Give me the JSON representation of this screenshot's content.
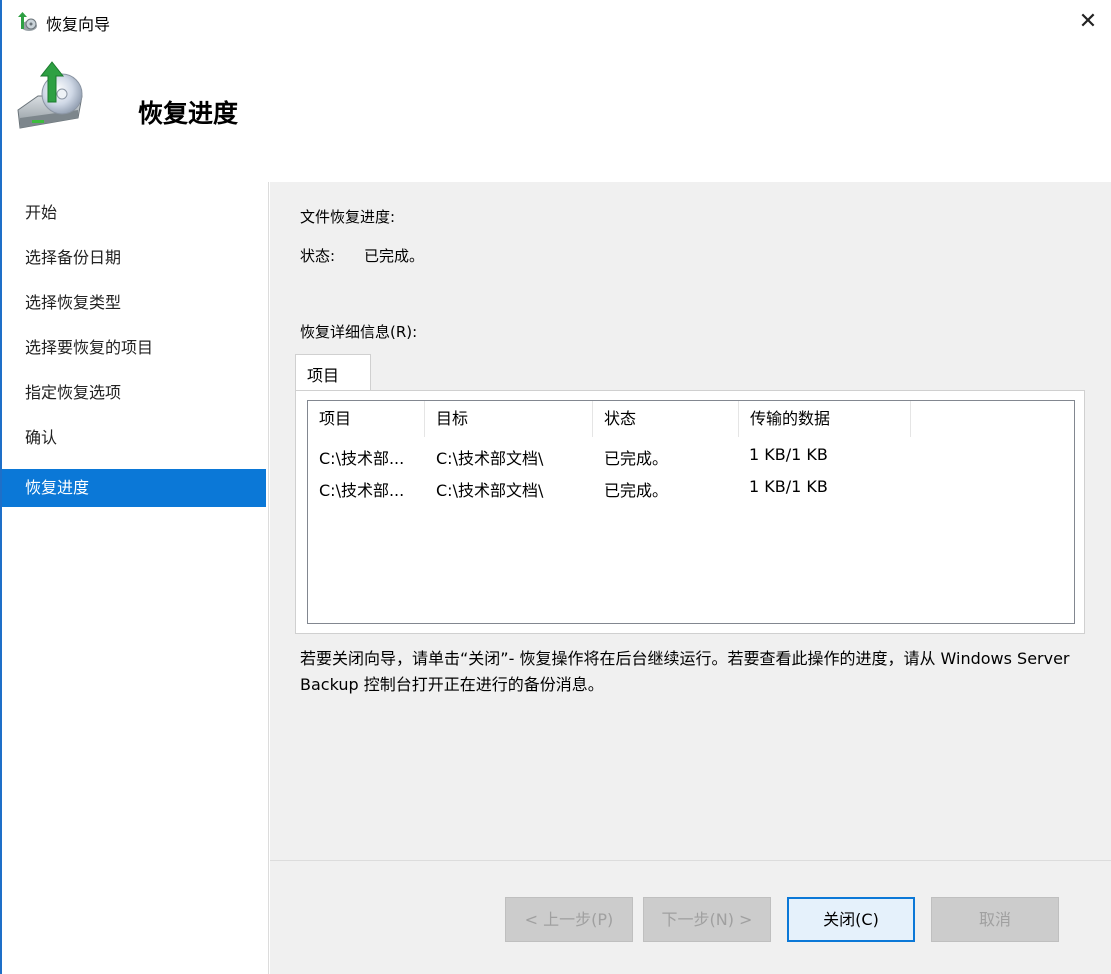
{
  "window": {
    "title": "恢复向导",
    "close_glyph": "✕"
  },
  "header": {
    "heading": "恢复进度"
  },
  "sidebar": {
    "steps": [
      {
        "label": "开始"
      },
      {
        "label": "选择备份日期"
      },
      {
        "label": "选择恢复类型"
      },
      {
        "label": "选择要恢复的项目"
      },
      {
        "label": "指定恢复选项"
      },
      {
        "label": "确认"
      },
      {
        "label": "恢复进度",
        "active": true
      }
    ]
  },
  "main": {
    "progress_title": "文件恢复进度:",
    "status_label": "状态:",
    "status_value": "已完成。",
    "details_label": "恢复详细信息(R):",
    "tab_label": "项目",
    "columns": [
      "项目",
      "目标",
      "状态",
      "传输的数据"
    ],
    "rows": [
      [
        "C:\\技术部...",
        "C:\\技术部文档\\",
        "已完成。",
        "1 KB/1 KB"
      ],
      [
        "C:\\技术部...",
        "C:\\技术部文档\\",
        "已完成。",
        "1 KB/1 KB"
      ]
    ],
    "note": "若要关闭向导，请单击“关闭”- 恢复操作将在后台继续运行。若要查看此操作的进度，请从 Windows Server Backup 控制台打开正在进行的备份消息。"
  },
  "footer": {
    "prev_label": "< 上一步(P)",
    "next_label": "下一步(N) >",
    "close_label": "关闭(C)",
    "cancel_label": "取消"
  },
  "colors": {
    "accent": "#0b78d7",
    "panel_bg": "#f0f0f0",
    "window_border": "#1e6fc8"
  },
  "icons": {
    "app": "backup-wizard-icon",
    "header": "disk-restore-icon",
    "close": "close-icon"
  }
}
